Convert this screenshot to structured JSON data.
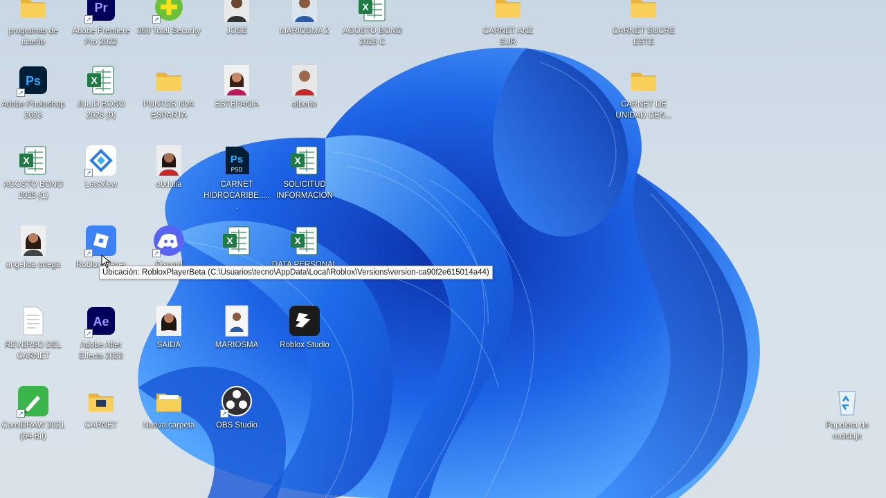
{
  "desktop": {
    "icons": [
      {
        "label": "programas de diseño",
        "icon": "folder-icon"
      },
      {
        "label": "Adobe Premiere Pro 2022",
        "icon": "premiere-icon"
      },
      {
        "label": "360 Total Security",
        "icon": "security-icon"
      },
      {
        "label": "JOSE",
        "icon": "photo-icon"
      },
      {
        "label": "MARIOSMA 2",
        "icon": "photo-icon"
      },
      {
        "label": "AGOSTO BONO 2025 C",
        "icon": "excel-icon"
      },
      {
        "label": "CARNET ANZ SUR",
        "icon": "folder-icon"
      },
      {
        "label": "CARNET SUCRE ESTE",
        "icon": "folder-icon"
      },
      {
        "label": "Adobe Photoshop 2023",
        "icon": "photoshop-icon"
      },
      {
        "label": "JULIO BONO 2025 (9)",
        "icon": "excel-icon"
      },
      {
        "label": "PUNTOS NVA ESPARTA",
        "icon": "folder-icon"
      },
      {
        "label": "ESTEFANIA",
        "icon": "photo-icon"
      },
      {
        "label": "alberto",
        "icon": "photo-icon"
      },
      {
        "label": "CARNET DE UNIDAD CEN...",
        "icon": "folder-icon"
      },
      {
        "label": "AGOSTO BONO 2025 (1)",
        "icon": "excel-icon"
      },
      {
        "label": "LetsView",
        "icon": "letsview-icon"
      },
      {
        "label": "obdulia",
        "icon": "photo-icon"
      },
      {
        "label": "CARNET HIDROCARIBE......",
        "icon": "psd-icon"
      },
      {
        "label": "SOLICITUD INFORMACION",
        "icon": "excel-icon"
      },
      {
        "label": "angelica ortega",
        "icon": "photo-icon"
      },
      {
        "label": "Roblox Player",
        "icon": "roblox-icon"
      },
      {
        "label": "Discord",
        "icon": "discord-icon"
      },
      {
        "label": "",
        "icon": "excel-icon"
      },
      {
        "label": "DATA PERSONAL",
        "icon": "excel-icon"
      },
      {
        "label": "REVERSO DEL CARNET",
        "icon": "document-icon"
      },
      {
        "label": "Adobe After Effects 2023",
        "icon": "aftereffects-icon"
      },
      {
        "label": "SAIDA",
        "icon": "photo-icon"
      },
      {
        "label": "MARIOSMA",
        "icon": "photo-icon"
      },
      {
        "label": "Roblox Studio",
        "icon": "roblox-studio-icon"
      },
      {
        "label": "CorelDRAW 2021 (64-Bit)",
        "icon": "coreldraw-icon"
      },
      {
        "label": "CARNET",
        "icon": "folder-icon"
      },
      {
        "label": "Nueva carpeta",
        "icon": "folder-icon"
      },
      {
        "label": "OBS Studio",
        "icon": "obs-icon"
      },
      {
        "label": "Papelera de reciclaje",
        "icon": "recycle-bin-icon"
      }
    ]
  },
  "tooltip": {
    "text": "Ubicación: RobloxPlayerBeta (C:\\Usuarios\\tecno\\AppData\\Local\\Roblox\\Versions\\version-ca90f2e615014a44)"
  },
  "colors": {
    "wallpaper_blue": "#1d5fe0",
    "excel_green": "#1f7a45",
    "photoshop_bg": "#001e36",
    "photoshop_fg": "#31a8ff",
    "folder_yellow": "#f7cf59"
  }
}
